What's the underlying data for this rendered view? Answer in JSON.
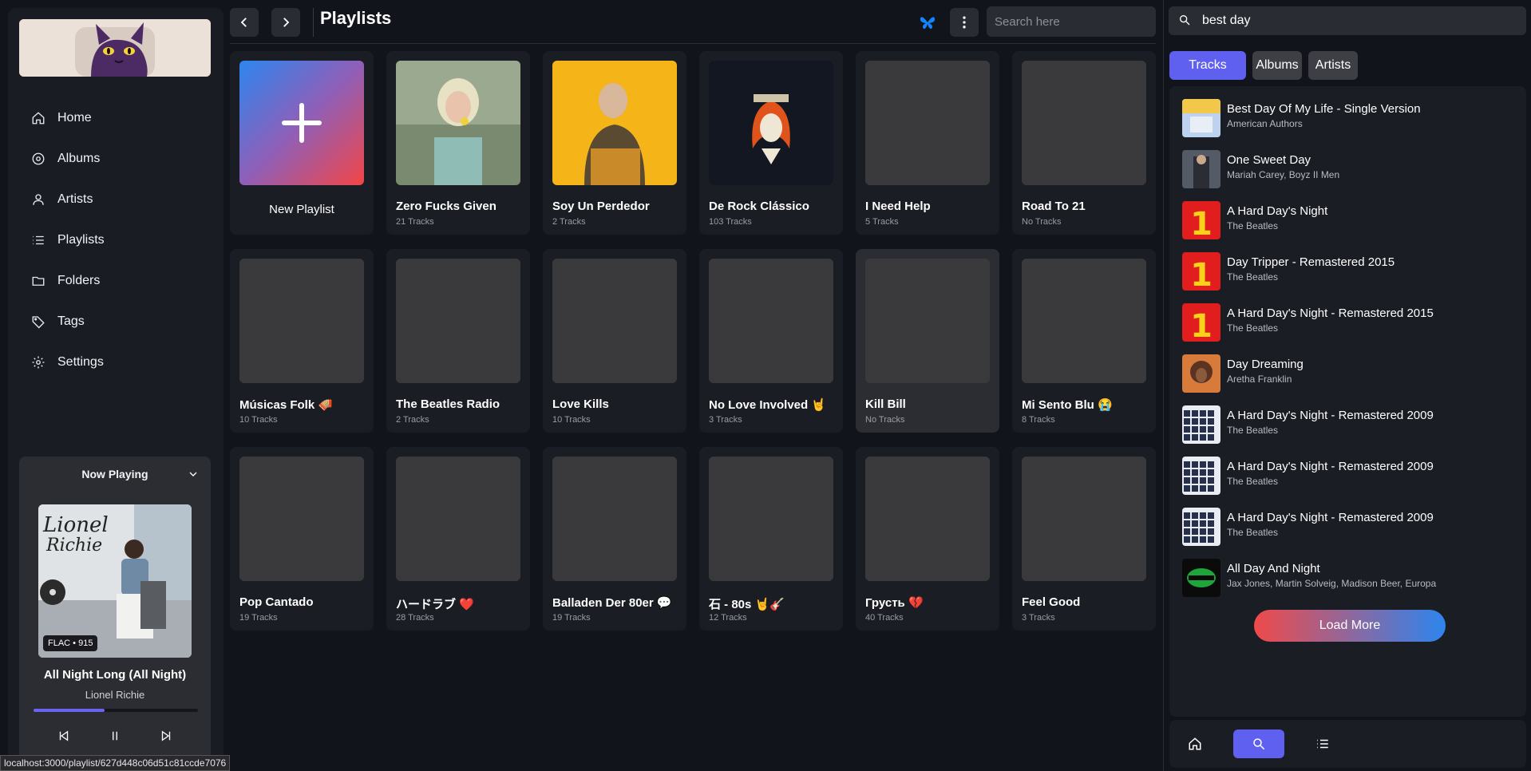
{
  "sidebar": {
    "nav": [
      {
        "label": "Home",
        "icon": "home-icon"
      },
      {
        "label": "Albums",
        "icon": "album-icon"
      },
      {
        "label": "Artists",
        "icon": "user-icon"
      },
      {
        "label": "Playlists",
        "icon": "list-icon"
      },
      {
        "label": "Folders",
        "icon": "folder-icon"
      },
      {
        "label": "Tags",
        "icon": "tag-icon"
      },
      {
        "label": "Settings",
        "icon": "gear-icon"
      }
    ]
  },
  "now_playing": {
    "heading": "Now Playing",
    "badge": "FLAC • 915",
    "title": "All Night Long (All Night)",
    "artist": "Lionel Richie",
    "progress": 0.43
  },
  "topbar": {
    "title": "Playlists",
    "search_placeholder": "Search here"
  },
  "playlists": [
    {
      "name": "New Playlist",
      "count": ""
    },
    {
      "name": "Zero Fucks Given",
      "count": "21 Tracks"
    },
    {
      "name": "Soy Un Perdedor",
      "count": "2 Tracks"
    },
    {
      "name": "De Rock Clássico",
      "count": "103 Tracks"
    },
    {
      "name": "I Need Help",
      "count": "5 Tracks"
    },
    {
      "name": "Road To 21",
      "count": "No Tracks"
    },
    {
      "name": "Músicas Folk 🪗",
      "count": "10 Tracks"
    },
    {
      "name": "The Beatles Radio",
      "count": "2 Tracks"
    },
    {
      "name": "Love Kills",
      "count": "10 Tracks"
    },
    {
      "name": "No Love Involved 🤘",
      "count": "3 Tracks"
    },
    {
      "name": "Kill Bill",
      "count": "No Tracks"
    },
    {
      "name": "Mi Sento Blu 😭",
      "count": "8 Tracks"
    },
    {
      "name": "Pop Cantado",
      "count": "19 Tracks"
    },
    {
      "name": "ハードラブ ❤️",
      "count": "28 Tracks"
    },
    {
      "name": "Balladen Der 80er 💬",
      "count": "19 Tracks"
    },
    {
      "name": "石 - 80s 🤘🎸",
      "count": "12 Tracks"
    },
    {
      "name": "Грусть 💔",
      "count": "40 Tracks"
    },
    {
      "name": "Feel Good",
      "count": "3 Tracks"
    }
  ],
  "search": {
    "query": "best day",
    "tabs": [
      "Tracks",
      "Albums",
      "Artists"
    ],
    "results": [
      {
        "title": "Best Day Of My Life - Single Version",
        "artist": "American Authors"
      },
      {
        "title": "One Sweet Day",
        "artist": "Mariah Carey, Boyz II Men"
      },
      {
        "title": "A Hard Day's Night",
        "artist": "The Beatles"
      },
      {
        "title": "Day Tripper - Remastered 2015",
        "artist": "The Beatles"
      },
      {
        "title": "A Hard Day's Night - Remastered 2015",
        "artist": "The Beatles"
      },
      {
        "title": "Day Dreaming",
        "artist": "Aretha Franklin"
      },
      {
        "title": "A Hard Day's Night - Remastered 2009",
        "artist": "The Beatles"
      },
      {
        "title": "A Hard Day's Night - Remastered 2009",
        "artist": "The Beatles"
      },
      {
        "title": "A Hard Day's Night - Remastered 2009",
        "artist": "The Beatles"
      },
      {
        "title": "All Day And Night",
        "artist": "Jax Jones, Martin Solveig, Madison Beer, Europa"
      }
    ],
    "load_more": "Load More"
  },
  "statusbar": "localhost:3000/playlist/627d448c06d51c81ccde7076",
  "colors": {
    "accent": "#6060f0",
    "bg": "#12141b",
    "card": "#1b1d24"
  }
}
